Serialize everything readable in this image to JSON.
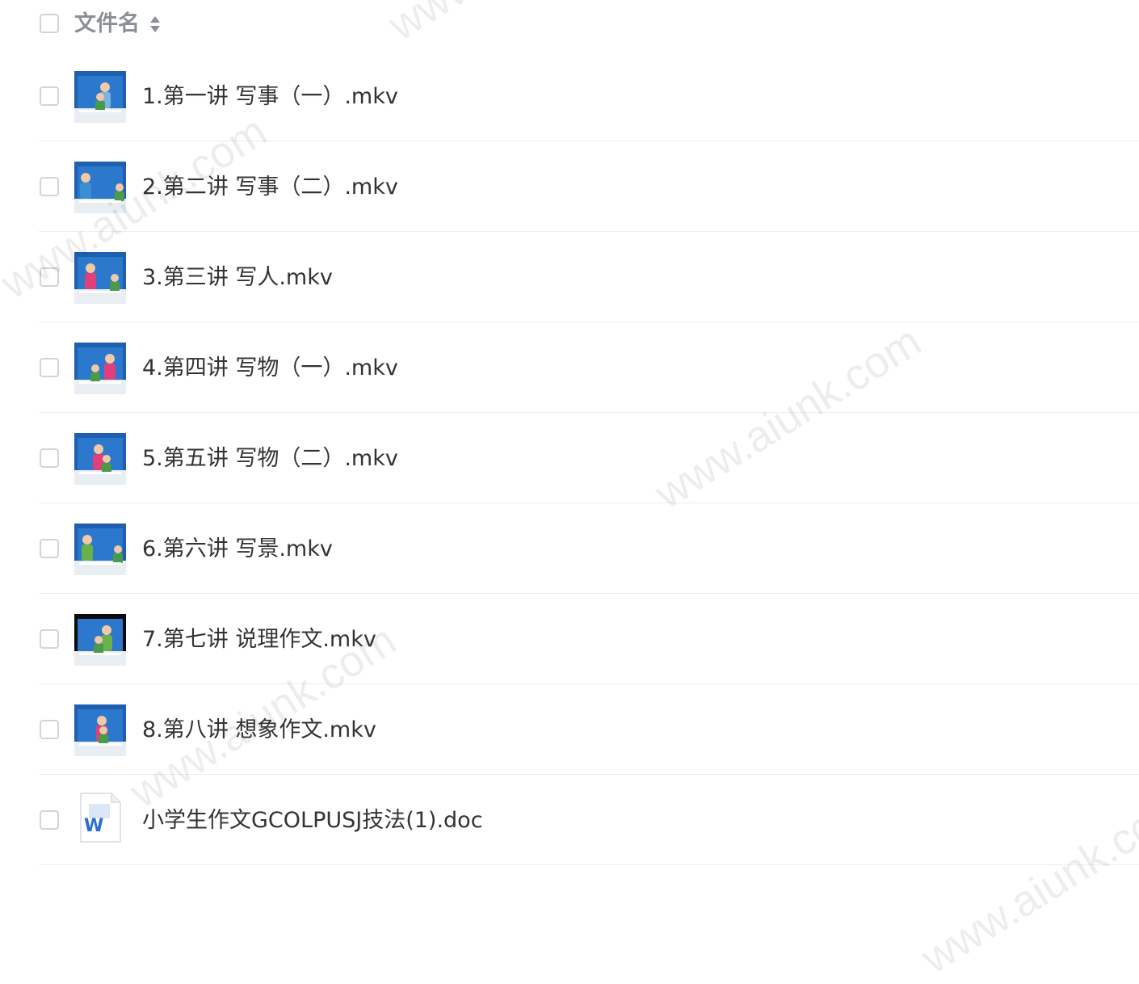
{
  "header": {
    "column_label": "文件名",
    "sort_icon": "sort-icon"
  },
  "files": [
    {
      "name": "1.第一讲 写事（一）.mkv",
      "type": "video",
      "thumb": "t1"
    },
    {
      "name": "2.第二讲 写事（二）.mkv",
      "type": "video",
      "thumb": "t2"
    },
    {
      "name": "3.第三讲 写人.mkv",
      "type": "video",
      "thumb": "t3"
    },
    {
      "name": "4.第四讲 写物（一）.mkv",
      "type": "video",
      "thumb": "t4"
    },
    {
      "name": "5.第五讲 写物（二）.mkv",
      "type": "video",
      "thumb": "t5"
    },
    {
      "name": "6.第六讲 写景.mkv",
      "type": "video",
      "thumb": "t6"
    },
    {
      "name": "7.第七讲 说理作文.mkv",
      "type": "video",
      "thumb": "t7"
    },
    {
      "name": "8.第八讲 想象作文.mkv",
      "type": "video",
      "thumb": "t8"
    },
    {
      "name": "小学生作文GCOLPUSJ技法(1).doc",
      "type": "doc",
      "thumb": "word-icon"
    }
  ],
  "watermark": {
    "text": "www.aiunk.com"
  },
  "colors": {
    "thumb_blue": "#1f5fb0",
    "thumb_dark": "#0d2f6b",
    "word_blue": "#2a6dd6"
  }
}
